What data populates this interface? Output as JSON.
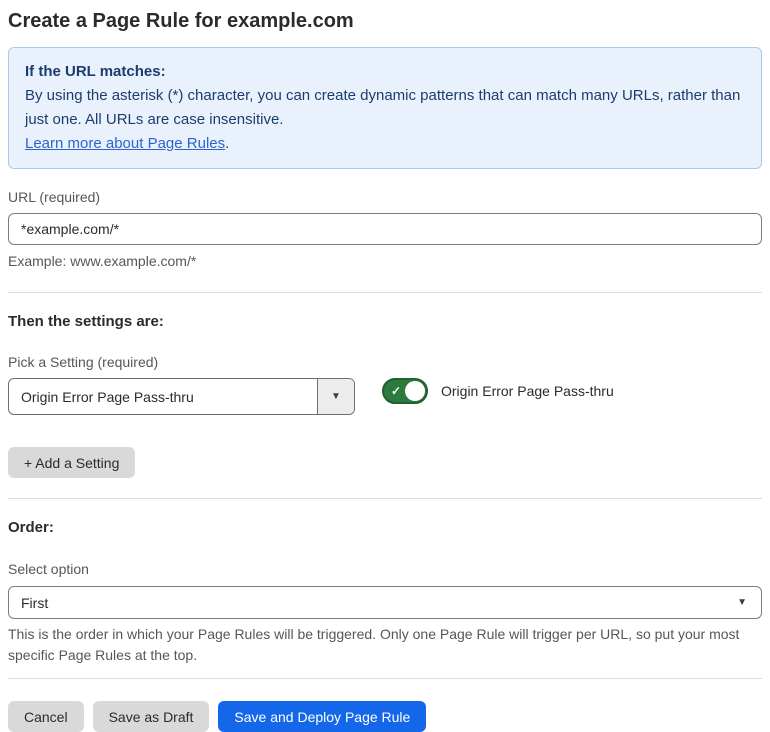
{
  "page": {
    "title": "Create a Page Rule for example.com"
  },
  "info_box": {
    "heading": "If the URL matches:",
    "body": "By using the asterisk (*) character, you can create dynamic patterns that can match many URLs, rather than just one. All URLs are case insensitive.",
    "link_label": "Learn more about Page Rules",
    "link_suffix": "."
  },
  "url_field": {
    "label": "URL (required)",
    "value": "*example.com/*",
    "helper": "Example: www.example.com/*"
  },
  "settings": {
    "heading": "Then the settings are:",
    "picker_label": "Pick a Setting (required)",
    "picker_value": "Origin Error Page Pass-thru",
    "toggle_state": "on",
    "toggle_label": "Origin Error Page Pass-thru",
    "add_setting_label": "+ Add a Setting"
  },
  "order": {
    "heading": "Order:",
    "select_label": "Select option",
    "select_value": "First",
    "helper": "This is the order in which your Page Rules will be triggered. Only one Page Rule will trigger per URL, so put your most specific Page Rules at the top."
  },
  "footer": {
    "cancel_label": "Cancel",
    "save_draft_label": "Save as Draft",
    "save_deploy_label": "Save and Deploy Page Rule"
  },
  "icons": {
    "toggle_check": "✓",
    "dropdown_arrow": "▼"
  },
  "colors": {
    "info_box_bg": "#e9f2fc",
    "info_box_border": "#a9c9ee",
    "info_box_text": "#1d3c6e",
    "link_blue": "#2c64cc",
    "primary_button_blue": "#1467e8",
    "secondary_button_gray": "#d9d9d9",
    "toggle_on_green": "#2c7a3e",
    "label_gray": "#56565c",
    "divider_gray": "#dcdcdc"
  }
}
